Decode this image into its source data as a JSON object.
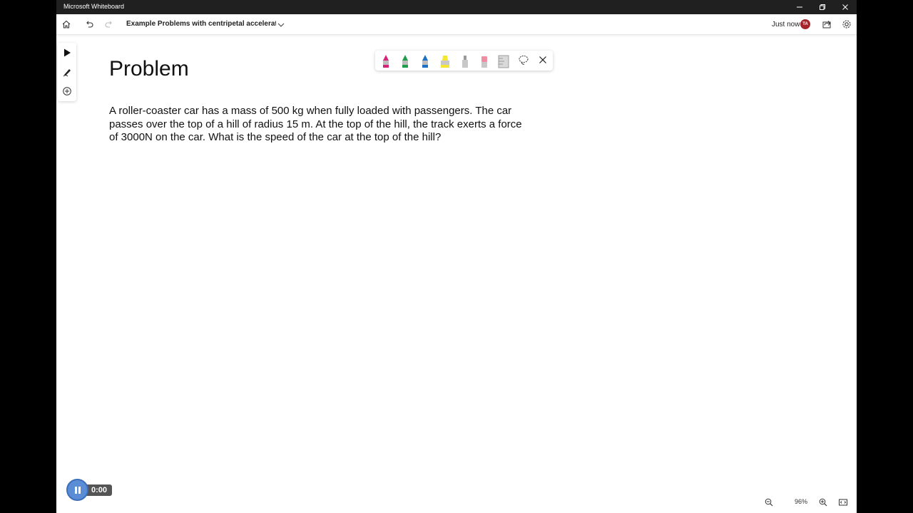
{
  "window": {
    "title": "Microsoft Whiteboard",
    "controls": [
      "minimize-icon",
      "restore-icon",
      "close-icon"
    ]
  },
  "toolbar": {
    "board_title": "Example Problems with centripetal acceleration",
    "save_status": "Just now",
    "avatar_initials": "TA",
    "avatar_color": "#a4262c",
    "icons": [
      "home-icon",
      "undo-icon",
      "redo-icon",
      "chevron-down-icon",
      "share-icon",
      "gear-icon"
    ]
  },
  "left_tools": [
    "select-pointer-icon",
    "pen-icon",
    "add-icon"
  ],
  "ink_toolbar": {
    "pens": [
      {
        "name": "pen-pink",
        "color": "#d6247a"
      },
      {
        "name": "pen-green",
        "color": "#1e9e4a"
      },
      {
        "name": "pen-blue",
        "color": "#1f6fc4"
      },
      {
        "name": "highlighter-yellow",
        "color": "#f4e634"
      },
      {
        "name": "pen-gray",
        "color": "#9a9a9a"
      },
      {
        "name": "eraser",
        "color": "#ef8ea0"
      },
      {
        "name": "ruler",
        "color": "#8a8a8a"
      }
    ],
    "icons": [
      "lasso-icon",
      "close-icon"
    ]
  },
  "canvas": {
    "heading": "Problem",
    "problem_text": "A roller-coaster car has a mass of 500 kg when fully loaded with passengers.  The car passes over the top of a hill of radius 15 m.  At the top of the hill, the track exerts a force of 3000N on the car.  What is the speed of the car at the top of the hill?"
  },
  "recorder": {
    "time": "0:00",
    "state": "recording",
    "accent": "#5b8dd6"
  },
  "zoom": {
    "level": "96%",
    "icons": [
      "zoom-out-icon",
      "zoom-in-icon",
      "fit-screen-icon"
    ]
  }
}
